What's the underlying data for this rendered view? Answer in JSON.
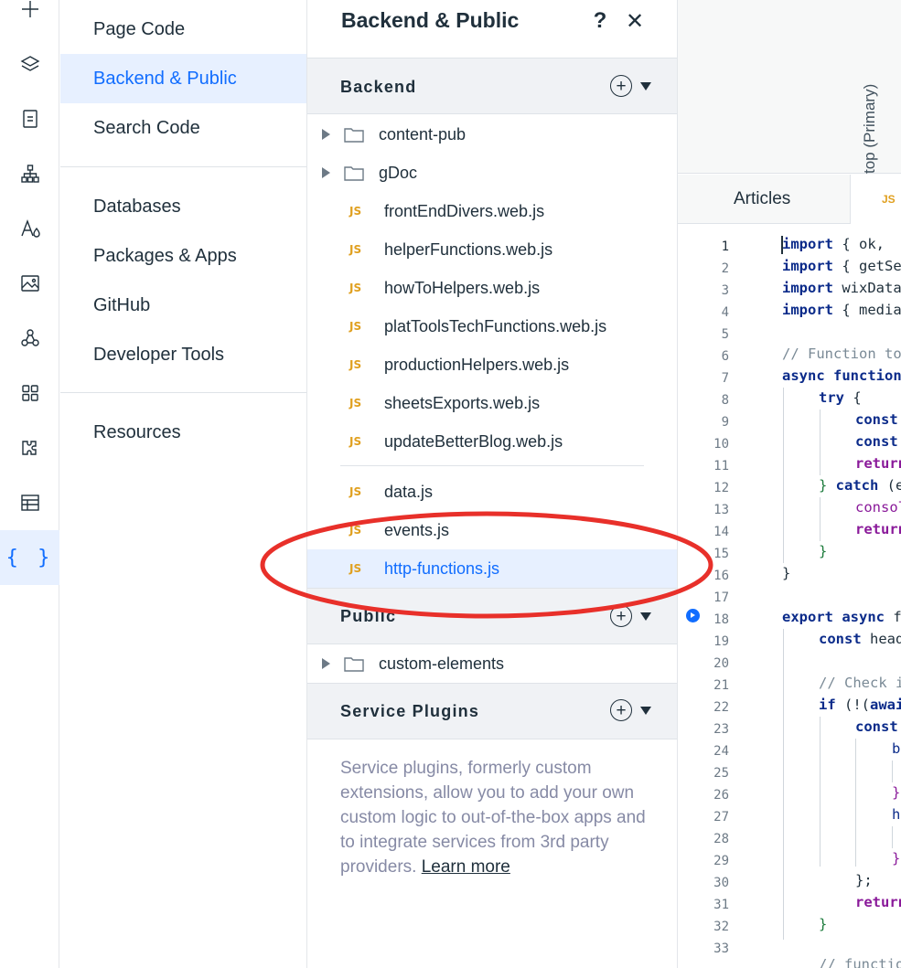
{
  "rail": {
    "icons": [
      "plus-icon",
      "layers-icon",
      "page-icon",
      "sitemap-icon",
      "typography-icon",
      "image-icon",
      "connections-icon",
      "apps-grid-icon",
      "puzzle-icon",
      "table-icon",
      "code-braces-icon"
    ],
    "active": "code-braces-icon",
    "braces_glyph": "{ }"
  },
  "nav": {
    "items": [
      {
        "label": "Page Code",
        "active": false
      },
      {
        "label": "Backend & Public",
        "active": true
      },
      {
        "label": "Search Code",
        "active": false
      },
      {
        "label": "Databases",
        "active": false
      },
      {
        "label": "Packages & Apps",
        "active": false
      },
      {
        "label": "GitHub",
        "active": false
      },
      {
        "label": "Developer Tools",
        "active": false
      },
      {
        "label": "Resources",
        "active": false
      }
    ]
  },
  "panel": {
    "title": "Backend & Public",
    "help_label": "?",
    "close_label": "✕",
    "backend": {
      "label": "Backend",
      "add_label": "+",
      "folders": [
        "content-pub",
        "gDoc"
      ],
      "web_files": [
        "frontEndDivers.web.js",
        "helperFunctions.web.js",
        "howToHelpers.web.js",
        "platToolsTechFunctions.web.js",
        "productionHelpers.web.js",
        "sheetsExports.web.js",
        "updateBetterBlog.web.js"
      ],
      "files": [
        "data.js",
        "events.js",
        "http-functions.js"
      ],
      "selected": "http-functions.js"
    },
    "public": {
      "label": "Public",
      "add_label": "+",
      "folders": [
        "custom-elements"
      ]
    },
    "service_plugins": {
      "label": "Service Plugins",
      "add_label": "+",
      "description": "Service plugins, formerly custom extensions, allow you to add your own custom logic to out-of-the-box apps and to integrate services from 3rd party providers.",
      "learn_more": "Learn more"
    },
    "js_badge": "JS"
  },
  "editor": {
    "vertical_label": "top (Primary)",
    "tabs": [
      {
        "label": "Articles",
        "icon": "page-icon"
      },
      {
        "label": "JS",
        "icon": "js-file-icon"
      }
    ],
    "line_numbers": [
      "1",
      "2",
      "3",
      "4",
      "5",
      "6",
      "7",
      "8",
      "9",
      "10",
      "11",
      "12",
      "13",
      "14",
      "15",
      "16",
      "17",
      "18",
      "19",
      "20",
      "21",
      "22",
      "23",
      "24",
      "25",
      "26",
      "27",
      "28",
      "29",
      "30",
      "31",
      "32",
      "33"
    ],
    "code": {
      "l1a": "import",
      "l1b": " { ok, ",
      "l2a": "import",
      "l2b": " { getSe",
      "l3a": "import",
      "l3b": " wixData",
      "l4a": "import",
      "l4b": " { media",
      "l6": "// Function to",
      "l7a": "async",
      "l7b": " function",
      "l8a": "try",
      "l8b": " {",
      "l9": "const",
      "l10": "const",
      "l11": "return",
      "l12a": "} ",
      "l12b": "catch",
      "l12c": " (e",
      "l13": "consol",
      "l14": "return",
      "l15": "}",
      "l16": "}",
      "l18a": "export",
      "l18b": " async",
      "l18c": " f",
      "l19a": "const",
      "l19b": " head",
      "l21": "// Check i",
      "l22a": "if",
      "l22b": " (!(",
      "l22c": "awai",
      "l23": "const",
      "l24": "bo",
      "l26": "}",
      "l27": "he",
      "l29": "}",
      "l30": "};",
      "l31": "return",
      "l32": "}",
      "l34": "// functio"
    }
  },
  "colors": {
    "accent": "#116dff",
    "highlight_ring": "#e8302a",
    "selected_bg": "#e7f0ff",
    "js_badge": "#e0a020"
  }
}
